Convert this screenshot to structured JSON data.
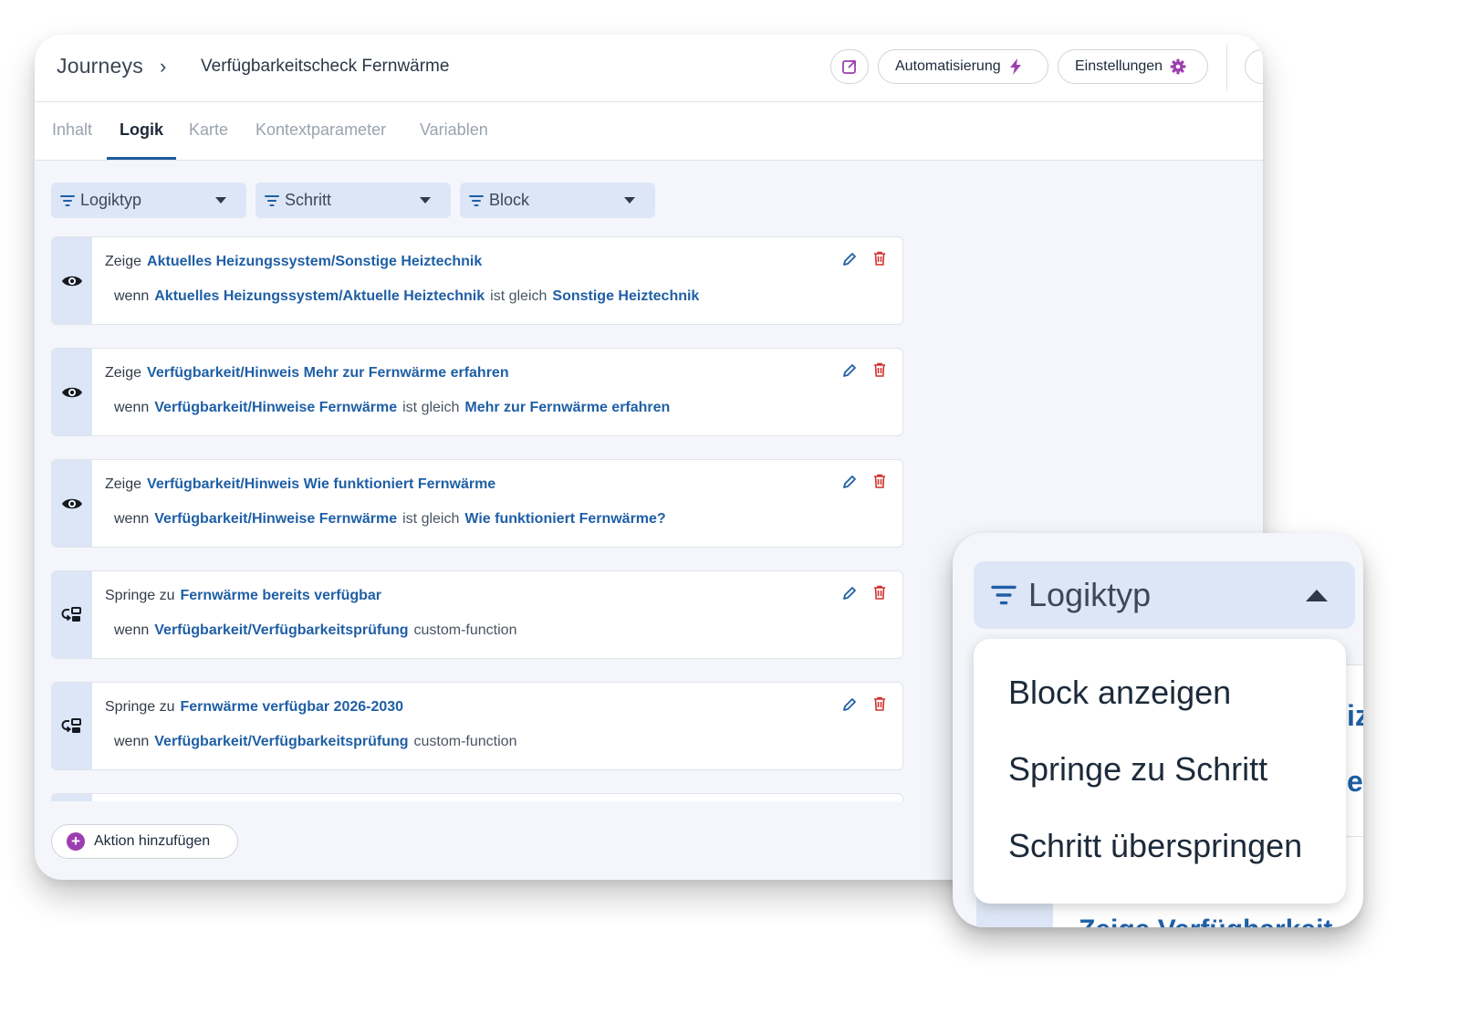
{
  "header": {
    "breadcrumb_root": "Journeys",
    "breadcrumb_separator": "›",
    "page_title": "Verfügbarkeitscheck Fernwärme",
    "automation_label": "Automatisierung",
    "settings_label": "Einstellungen"
  },
  "tabs": [
    {
      "label": "Inhalt",
      "active": false
    },
    {
      "label": "Logik",
      "active": true
    },
    {
      "label": "Karte",
      "active": false
    },
    {
      "label": "Kontextparameter",
      "active": false
    },
    {
      "label": "Variablen",
      "active": false
    }
  ],
  "filters": [
    {
      "label": "Logiktyp"
    },
    {
      "label": "Schritt"
    },
    {
      "label": "Block"
    }
  ],
  "rules": [
    {
      "icon": "eye-icon",
      "action": "Zeige",
      "target": "Aktuelles Heizungssystem/Sonstige Heiztechnik",
      "when": "wenn",
      "field": "Aktuelles Heizungssystem/Aktuelle Heiztechnik",
      "operator": "ist gleich",
      "value": "Sonstige Heiztechnik"
    },
    {
      "icon": "eye-icon",
      "action": "Zeige",
      "target": "Verfügbarkeit/Hinweis Mehr zur Fernwärme erfahren",
      "when": "wenn",
      "field": "Verfügbarkeit/Hinweise Fernwärme",
      "operator": "ist gleich",
      "value": "Mehr zur Fernwärme erfahren"
    },
    {
      "icon": "eye-icon",
      "action": "Zeige",
      "target": "Verfügbarkeit/Hinweis Wie funktioniert Fernwärme",
      "when": "wenn",
      "field": "Verfügbarkeit/Hinweise Fernwärme",
      "operator": "ist gleich",
      "value": "Wie funktioniert Fernwärme?"
    },
    {
      "icon": "jump-step-icon",
      "action": "Springe zu",
      "target": "Fernwärme bereits verfügbar",
      "when": "wenn",
      "field": "Verfügbarkeit/Verfügbarkeitsprüfung",
      "operator": "custom-function",
      "value": ""
    },
    {
      "icon": "jump-step-icon",
      "action": "Springe zu",
      "target": "Fernwärme verfügbar 2026-2030",
      "when": "wenn",
      "field": "Verfügbarkeit/Verfügbarkeitsprüfung",
      "operator": "custom-function",
      "value": ""
    }
  ],
  "add_action_label": "Aktion hinzufügen",
  "zoom": {
    "filter_label": "Logiktyp",
    "dropdown_options": [
      "Block anzeigen",
      "Springe zu Schritt",
      "Schritt überspringen"
    ],
    "bg_fragment_1": "iz",
    "bg_fragment_2": "ei",
    "bg_fragment_3": "Zeige Verfügbarkeit"
  },
  "colors": {
    "accent_link": "#1f5fa6",
    "accent_purple": "#9b3fb0",
    "delete_red": "#d0312d",
    "filter_bg": "#dde6f6",
    "tab_active_underline": "#1e5a9e"
  }
}
